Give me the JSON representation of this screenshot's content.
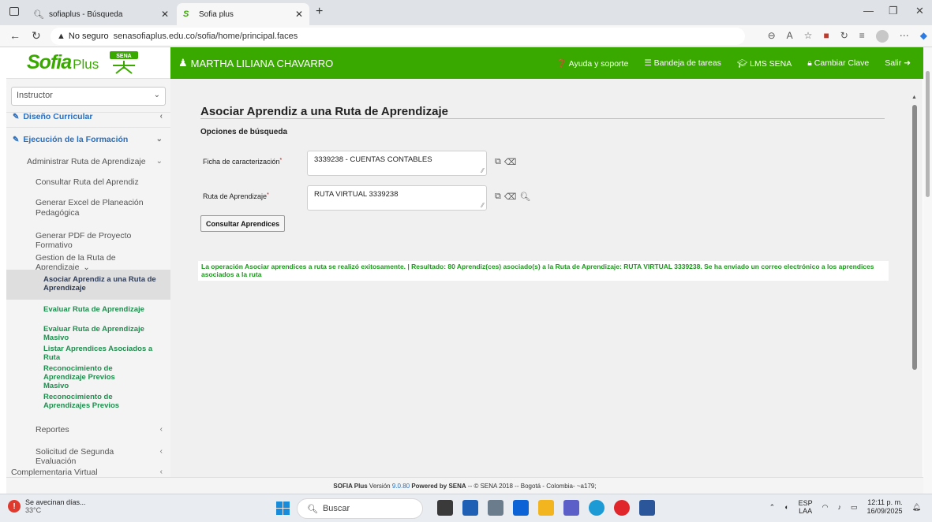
{
  "browser": {
    "tabs": [
      {
        "label": "sofiaplus - Búsqueda"
      },
      {
        "label": "Sofia plus"
      }
    ],
    "not_secure": "No seguro",
    "url": "senasofiaplus.edu.co/sofia/home/principal.faces"
  },
  "header": {
    "logo_main": "Sofia",
    "logo_plus": "Plus",
    "logo_sena_label": "SENA",
    "user_name": "MARTHA LILIANA CHAVARRO",
    "links": [
      "Ayuda y soporte",
      "Bandeja de tareas",
      "LMS SENA",
      "Cambiar Clave",
      "Salir"
    ],
    "brand_color": "#39a900"
  },
  "sidebar": {
    "role": "Instructor",
    "items": [
      {
        "label": "Diseño Curricular"
      },
      {
        "label": "Ejecución de la Formación"
      },
      {
        "label": "Administrar Ruta de Aprendizaje"
      },
      {
        "label": "Consultar Ruta del Aprendiz"
      },
      {
        "label": "Generar Excel de Planeación Pedagógica"
      },
      {
        "label": "Generar PDF de Proyecto Formativo"
      },
      {
        "label": "Gestion de la Ruta de Aprendizaje"
      },
      {
        "label": "Asociar Aprendiz a una Ruta de Aprendizaje"
      },
      {
        "label": "Evaluar Ruta de Aprendizaje"
      },
      {
        "label": "Evaluar Ruta de Aprendizaje Masivo"
      },
      {
        "label": "Listar Aprendices Asociados a Ruta"
      },
      {
        "label": "Reconocimiento de Aprendizaje Previos Masivo"
      },
      {
        "label": "Reconocimiento de Aprendizajes Previos"
      },
      {
        "label": "Reportes"
      },
      {
        "label": "Solicitud de Segunda Evaluación"
      },
      {
        "label": "Complementaria Virtual"
      }
    ]
  },
  "main": {
    "title": "Asociar Aprendiz a una Ruta de Aprendizaje",
    "section": "Opciones de búsqueda",
    "fields": {
      "ficha": {
        "label": "Ficha de caracterización",
        "value": "3339238 - CUENTAS CONTABLES"
      },
      "ruta": {
        "label": "Ruta de Aprendizaje",
        "value": "RUTA VIRTUAL 3339238"
      }
    },
    "button": "Consultar Aprendices",
    "success_message": "La operación Asociar aprendices a ruta se realizó exitosamente. | Resultado: 80 Aprendiz(ces) asociado(s) a la Ruta de Aprendizaje: RUTA VIRTUAL 3339238. Se ha enviado un correo electrónico a los aprendices asociados a la ruta"
  },
  "footer": {
    "brand": "SOFIA Plus",
    "version_label": "Versión",
    "version": "9.0.80",
    "powered": "Powered by SENA",
    "rest": "-- © SENA 2018 -- Bogotá - Colombia- ~a179;"
  },
  "taskbar": {
    "weather_text": "Se avecinan días...",
    "temperature": "33°C",
    "search_placeholder": "Buscar",
    "lang_1": "ESP",
    "lang_2": "LAA",
    "time": "12:11 p. m.",
    "date": "16/09/2025"
  }
}
